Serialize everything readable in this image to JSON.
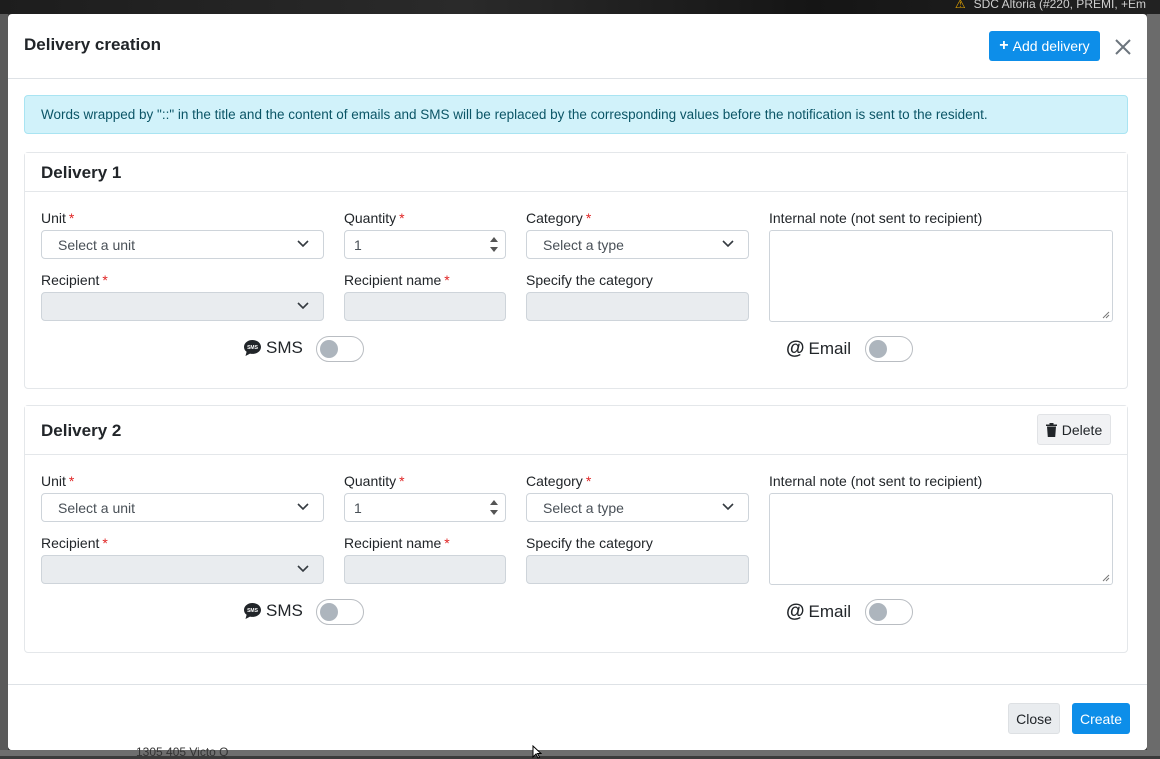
{
  "background": {
    "topbar_text": "SDC Altoria (#220, PREMI, +Em",
    "bottom_text": "1305 405 Victo Q"
  },
  "modal": {
    "title": "Delivery creation",
    "add_delivery_label": "Add delivery",
    "close_icon": "close-icon",
    "info_alert": "Words wrapped by \"::\" in the title and the content of emails and SMS will be replaced by the corresponding values before the notification is sent to the resident.",
    "deliveries": [
      {
        "title": "Delivery 1",
        "delete_label": null,
        "unit_label": "Unit",
        "unit_placeholder": "Select a unit",
        "quantity_label": "Quantity",
        "quantity_value": "1",
        "category_label": "Category",
        "category_placeholder": "Select a type",
        "note_label": "Internal note (not sent to recipient)",
        "recipient_label": "Recipient",
        "recipient_name_label": "Recipient name",
        "specify_category_label": "Specify the category",
        "sms_label": "SMS",
        "sms_on": false,
        "email_label": "Email",
        "email_on": false
      },
      {
        "title": "Delivery 2",
        "delete_label": "Delete",
        "unit_label": "Unit",
        "unit_placeholder": "Select a unit",
        "quantity_label": "Quantity",
        "quantity_value": "1",
        "category_label": "Category",
        "category_placeholder": "Select a type",
        "note_label": "Internal note (not sent to recipient)",
        "recipient_label": "Recipient",
        "recipient_name_label": "Recipient name",
        "specify_category_label": "Specify the category",
        "sms_label": "SMS",
        "sms_on": false,
        "email_label": "Email",
        "email_on": false
      }
    ],
    "required_marker": "*",
    "footer": {
      "close_label": "Close",
      "create_label": "Create"
    }
  },
  "colors": {
    "primary": "#0d8ee9",
    "info_bg": "#d1f2fa",
    "info_text": "#0b5566",
    "required": "#e02424"
  }
}
